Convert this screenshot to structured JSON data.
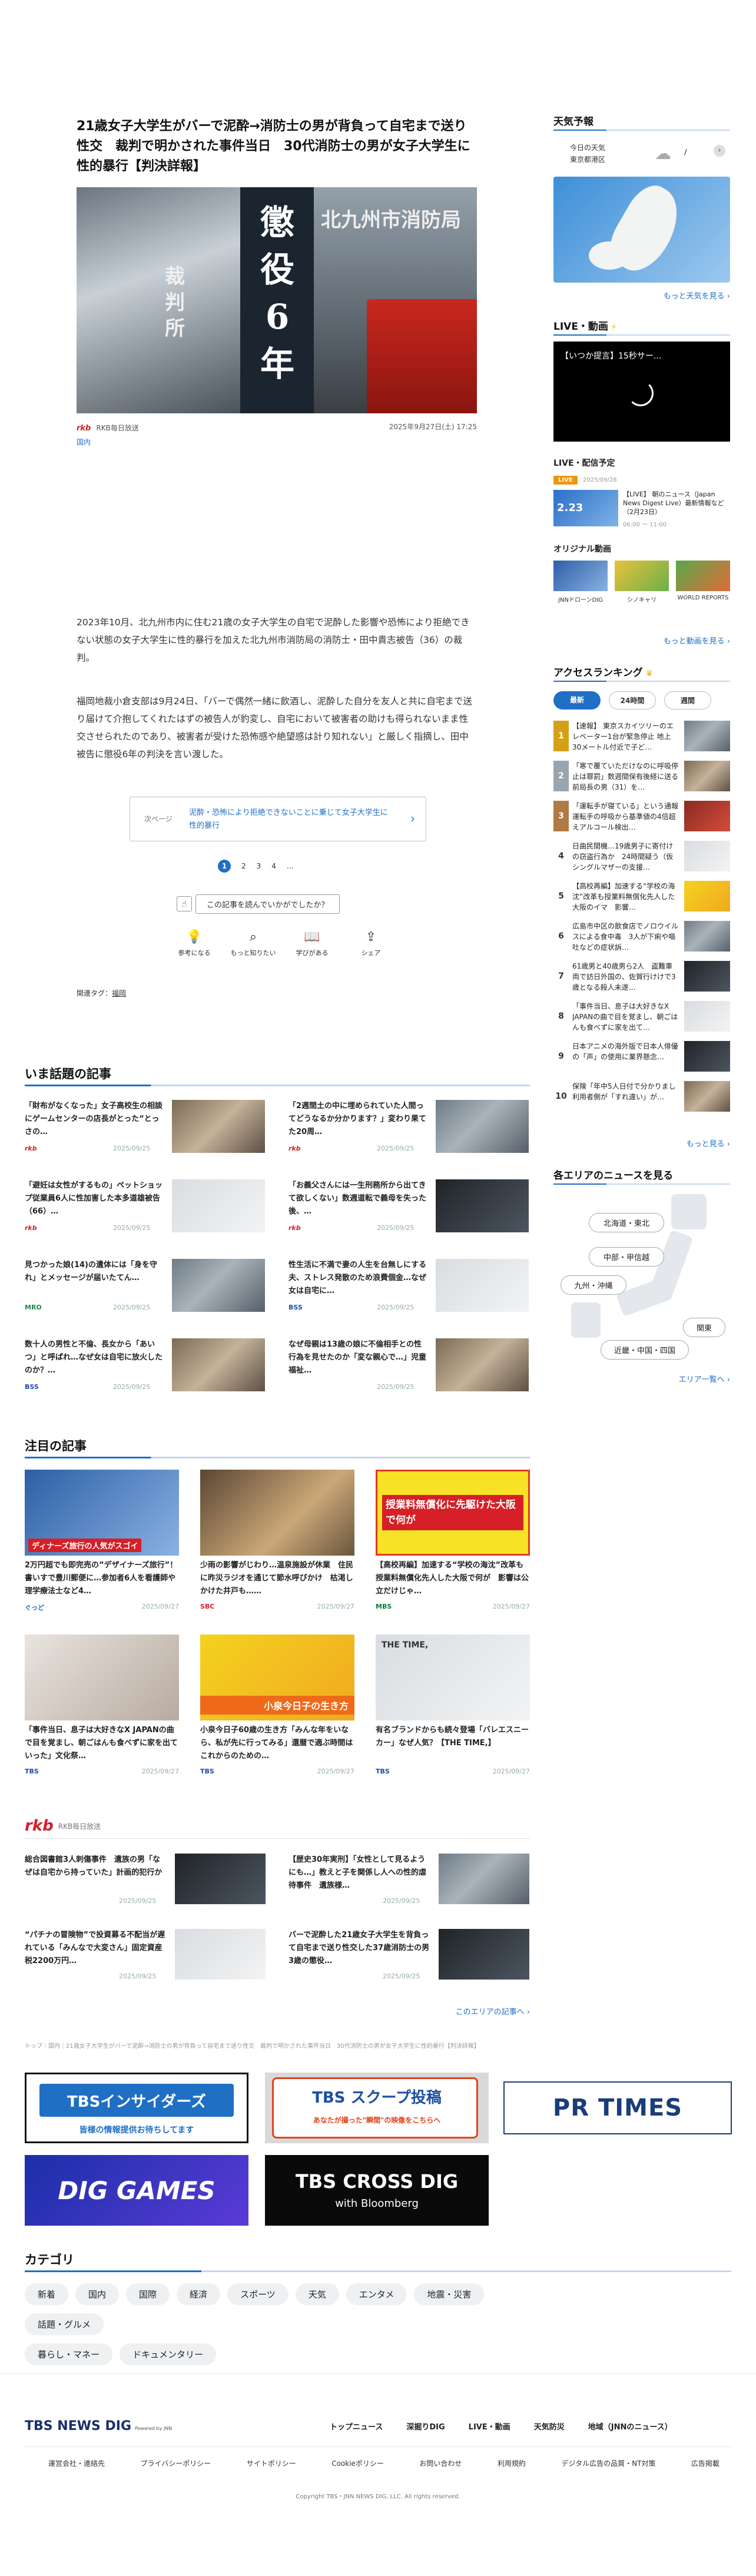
{
  "article": {
    "title": "21歳女子大学生がバーで泥酔→消防士の男が背負って自宅まで送り性交　裁判で明かされた事件当日　30代消防士の男が女子大学生に性的暴行【判決詳報】",
    "image_text_right": "北九州市消防局",
    "image_text_center": "懲役6年",
    "image_text_left": "裁判所",
    "source_logo": "rkb",
    "source": "RKB毎日放送",
    "datetime": "2025年9月27日(土) 17:25",
    "category": "国内",
    "paragraph1": "2023年10月、北九州市内に住む21歳の女子大学生の自宅で泥酔した影響や恐怖により拒絶できない状態の女子大学生に性的暴行を加えた北九州市消防局の消防士・田中貴志被告（36）の裁判。",
    "paragraph2": "福岡地裁小倉支部は9月24日、「バーで偶然一緒に飲酒し、泥酔した自分を友人と共に自宅まで送り届けて介抱してくれたはずの被告人が豹変し、自宅において被害者の助けも得られないまま性交させられたのであり、被害者が受けた恐怖感や絶望感は計り知れない」と厳しく指摘し、田中被告に懲役6年の判決を言い渡した。",
    "next_label": "次ページ",
    "next_text": "泥酔・恐怖により拒絶できないことに乗じて女子大学生に性的暴行",
    "pages": [
      "1",
      "2",
      "3",
      "4",
      "…"
    ],
    "feedback_question": "この記事を読んでいかがでしたか？",
    "reactions": [
      "参考になる",
      "もっと知りたい",
      "学びがある",
      "シェア"
    ],
    "related_tags_label": "関連タグ：",
    "related_tag": "福岡"
  },
  "trending": {
    "heading": "いま話題の記事",
    "items": [
      {
        "title": "「財布がなくなった」女子高校生の相談にゲームセンターの店長がとった“とっさの…",
        "src": "rkb",
        "date": "2025/09/25"
      },
      {
        "title": "「2週間土の中に埋められていた人間ってどうなるか分かります？」変わり果てた20周…",
        "src": "rkb",
        "date": "2025/09/25"
      },
      {
        "title": "「避妊は女性がするもの」ペットショップ従業員6人に性加害した本多道雄被告（66）…",
        "src": "rkb",
        "date": "2025/09/25"
      },
      {
        "title": "「お義父さんには一生刑務所から出てきて欲しくない」数週道転で義母を失った後、…",
        "src": "rkb",
        "date": "2025/09/25"
      },
      {
        "title": "見つかった娘(14)の遺体には「身を守れ」とメッセージが届いたてん…",
        "src": "MRO",
        "date": "2025/09/25"
      },
      {
        "title": "性生活に不満で妻の人生を台無しにする夫、ストレス発散のため浪費個金…なぜ女は自宅に…",
        "src": "BSS",
        "date": "2025/09/25"
      },
      {
        "title": "数十人の男性と不倫、長女から「あいつ」と呼ばれ…なぜ女は自宅に放火したのか？…",
        "src": "BSS",
        "date": "2025/09/25"
      },
      {
        "title": "なぜ母親は13歳の娘に不倫相手との性行為を見せたのか「変な親心で…」児童福祉…",
        "src": "",
        "date": "2025/09/25"
      }
    ]
  },
  "featured": {
    "heading": "注目の記事",
    "items": [
      {
        "title": "2万円超でも即完売の”デザイナーズ旅行”！ 書いすで豊川郵便に…参加者6人を看護師や理学療法士など4…",
        "src": "ぐっど",
        "date": "2025/09/27",
        "img": "ディナーズ旅行の人気がスゴイ"
      },
      {
        "title": "少雨の影響がじわり…温泉施設が休業　住民に昨災ラジオを通じて節水呼びかけ　枯渇しかけた井戸も……",
        "src": "SBC",
        "date": "2025/09/27",
        "img": ""
      },
      {
        "title": "【高校再編】加速する“学校の海沈”改革も授業料無償化先人した大阪で何が　影響は公立だけじゃ…",
        "src": "MBS",
        "date": "2025/09/27",
        "img": "授業料無償化に先駆けた大阪で何が"
      },
      {
        "title": "「事件当日、息子は大好きなX JAPANの曲で目を覚まし、朝ごはんも食べずに家を出ていった」文化祭…",
        "src": "TBS",
        "date": "2025/09/27",
        "img": ""
      },
      {
        "title": "小泉今日子60歳の生き方「みんな年をいなら、私が先に行ってみる」還暦で適ぶ時間はこれからのための…",
        "src": "TBS",
        "date": "2025/09/27",
        "img": "小泉今日子の生き方"
      },
      {
        "title": "有名ブランドからも続々登場「バレエスニーカー」なぜ人気？【THE TIME,】",
        "src": "TBS",
        "date": "2025/09/27",
        "img": "THE TIME,"
      }
    ]
  },
  "rkb_block": {
    "logo": "rkb",
    "label": "RKB毎日放送",
    "items": [
      {
        "title": "総合図書館3人刺傷事件　遺族の男「なぜは自宅から持っていた」計画的犯行か",
        "date": "2025/09/25"
      },
      {
        "title": "【歴史30年実刑】「女性として見るようにも…」教えと子を関係し人への性的虐待事件　遺族様…",
        "date": "2025/09/25"
      },
      {
        "title": "“パチナの冒険物”で投資募る不配当が遅れている「みんなで大変さん」固定資産税2200万円…",
        "date": "2025/09/25"
      },
      {
        "title": "バーで泥酔した21歳女子大学生を背負って自宅まで送り性交した37歳消防士の男　3歳の懲役…",
        "date": "2025/09/25"
      }
    ],
    "more": "このエリアの記事へ"
  },
  "breadcrumb": "トップ｜国内｜21歳女子大学生がバーで泥酔→消防士の男が背負って自宅まで送り性交　裁判で明かされた事件当日　30代消防士の男が女子大学生に性的暴行【判決詳報】",
  "banners": {
    "insider_title": "TBSインサイダーズ",
    "insider_sub": "皆様の情報提供お待ちしてます",
    "scoop_title": "TBS スクープ投稿",
    "scoop_sub": "あなたが撮った\"瞬間\"の映像をこちらへ",
    "prtimes": "PR TIMES",
    "dig_games": "DIG GAMES",
    "cross_dig": "TBS CROSS DIG",
    "cross_dig_sub": "with Bloomberg"
  },
  "categories": {
    "heading": "カテゴリ",
    "tags": [
      "新着",
      "国内",
      "国際",
      "経済",
      "スポーツ",
      "天気",
      "エンタメ",
      "地震・災害",
      "話題・グルメ",
      "暮らし・マネー",
      "ドキュメンタリー"
    ]
  },
  "footer": {
    "logo": "TBS NEWS DIG",
    "logo_sub": "Powered by JNN",
    "main_links": [
      "トップニュース",
      "深掘りDIG",
      "LIVE・動画",
      "天気防災",
      "地域（JNNのニュース）"
    ],
    "sub_links": [
      "運営会社・連絡先",
      "プライバシーポリシー",
      "サイトポリシー",
      "Cookieポリシー",
      "お問い合わせ",
      "利用規約",
      "デジタル広告の品質・NT対策",
      "広告掲載"
    ],
    "copyright": "Copyright TBS・JNN NEWS DIG, LLC. All rights reserved."
  },
  "sidebar": {
    "weather_heading": "天気予報",
    "weather_today": "今日の天気",
    "weather_area": "東京都港区",
    "weather_temp": "/",
    "weather_more": "もっと天気を見る",
    "live_heading": "LIVE・動画",
    "live_title": "【いつか提言】15秒サー...",
    "live_schedule_heading": "LIVE・配信予定",
    "live_badge": "LIVE",
    "live_schedule_date": "2025/09/28",
    "live_item_date": "2.23",
    "live_item_title": "【LIVE】 朝のニュース（Japan News Digest Live）最新情報など（2月23日）",
    "live_item_time": "06:00 ～ 11:00",
    "original_heading": "オリジナル動画",
    "original_videos": [
      "JNNドローンDIG",
      "シノキャリ",
      "WORLD REPORTS"
    ],
    "original_more": "もっと動画を見る",
    "ranking_heading": "アクセスランキング",
    "ranking_tabs": [
      "最新",
      "24時間",
      "週間"
    ],
    "ranking": [
      {
        "n": "1",
        "t": "【速報】 東京スカイツリーのエレベーター1台が緊急停止 地上30メートル付近で子ど…"
      },
      {
        "n": "2",
        "t": "「寒で覆ていただけなのに呼吸停止は罪罰」数週間保有後経に送る前局長の男（31）を…"
      },
      {
        "n": "3",
        "t": "「運転手が寝ている」という通報　運転手の呼吸から基準値の4倍超えアルコール検出…"
      },
      {
        "n": "4",
        "t": "日曲民間機…19歳男子に寄付けの窃盗行為か　24時間疑う（仮シングルマザーの支援…"
      },
      {
        "n": "5",
        "t": "【高校再編】加速する“学校の海沈”改革も授業料無償化先人した大阪のイマ　影響…"
      },
      {
        "n": "6",
        "t": "広島市中区の飲食店でノロウイルスによる食中毒　3人が下痢や嘔吐などの症状訴…"
      },
      {
        "n": "7",
        "t": "61歳男と40歳男ら2人　盗難車両で訪日外国の、佐賀行けけで3歳となる殺人未遂…"
      },
      {
        "n": "8",
        "t": "「事件当日、息子は大好きなX JAPANの曲で目を覚まし、朝ごはんも食べずに家を出て…"
      },
      {
        "n": "9",
        "t": "日本アニメの海外版で日本人俳優の「声」の使用に業界懸念…"
      },
      {
        "n": "10",
        "t": "保険「年中5人日付で分かりまし 利用者側が「すれ違い」が…"
      }
    ],
    "ranking_more": "もっと見る",
    "area_heading": "各エリアのニュースを見る",
    "areas": [
      "北海道・東北",
      "中部・甲信越",
      "九州・沖縄",
      "関東",
      "近畿・中国・四国"
    ],
    "area_more": "エリア一覧へ"
  }
}
